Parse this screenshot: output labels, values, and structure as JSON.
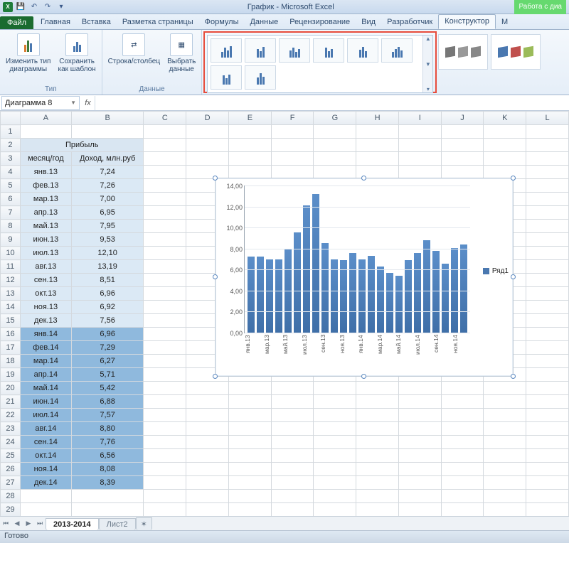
{
  "app": {
    "title": "График - Microsoft Excel",
    "chart_tools": "Работа с диа"
  },
  "qat": {
    "save": "save-icon",
    "undo": "undo-icon",
    "redo": "redo-icon"
  },
  "tabs": {
    "file": "Файл",
    "items": [
      "Главная",
      "Вставка",
      "Разметка страницы",
      "Формулы",
      "Данные",
      "Рецензирование",
      "Вид",
      "Разработчик"
    ],
    "active": "Конструктор",
    "more": "М"
  },
  "ribbon": {
    "type_group": {
      "change": "Изменить тип\nдиаграммы",
      "save_tpl": "Сохранить\nкак шаблон",
      "label": "Тип"
    },
    "data_group": {
      "switch": "Строка/столбец",
      "select": "Выбрать\nданные",
      "label": "Данные"
    },
    "styles_3d": [
      "preset-1",
      "preset-2"
    ]
  },
  "namebox": "Диаграмма 8",
  "fx_label": "fx",
  "columns": [
    "A",
    "B",
    "C",
    "D",
    "E",
    "F",
    "G",
    "H",
    "I",
    "J",
    "K",
    "L"
  ],
  "table": {
    "title": "Прибыль",
    "h1": "месяц/год",
    "h2": "Доход, млн.руб",
    "rows": [
      {
        "m": "янв.13",
        "v": "7,24",
        "cls": "d13"
      },
      {
        "m": "фев.13",
        "v": "7,26",
        "cls": "d13"
      },
      {
        "m": "мар.13",
        "v": "7,00",
        "cls": "d13"
      },
      {
        "m": "апр.13",
        "v": "6,95",
        "cls": "d13"
      },
      {
        "m": "май.13",
        "v": "7,95",
        "cls": "d13"
      },
      {
        "m": "июн.13",
        "v": "9,53",
        "cls": "d13"
      },
      {
        "m": "июл.13",
        "v": "12,10",
        "cls": "d13"
      },
      {
        "m": "авг.13",
        "v": "13,19",
        "cls": "d13"
      },
      {
        "m": "сен.13",
        "v": "8,51",
        "cls": "d13"
      },
      {
        "m": "окт.13",
        "v": "6,96",
        "cls": "d13"
      },
      {
        "m": "ноя.13",
        "v": "6,92",
        "cls": "d13"
      },
      {
        "m": "дек.13",
        "v": "7,56",
        "cls": "d13"
      },
      {
        "m": "янв.14",
        "v": "6,96",
        "cls": "d14"
      },
      {
        "m": "фев.14",
        "v": "7,29",
        "cls": "d14"
      },
      {
        "m": "мар.14",
        "v": "6,27",
        "cls": "d14"
      },
      {
        "m": "апр.14",
        "v": "5,71",
        "cls": "d14"
      },
      {
        "m": "май.14",
        "v": "5,42",
        "cls": "d14"
      },
      {
        "m": "июн.14",
        "v": "6,88",
        "cls": "d14"
      },
      {
        "m": "июл.14",
        "v": "7,57",
        "cls": "d14"
      },
      {
        "m": "авг.14",
        "v": "8,80",
        "cls": "d14"
      },
      {
        "m": "сен.14",
        "v": "7,76",
        "cls": "d14"
      },
      {
        "m": "окт.14",
        "v": "6,56",
        "cls": "d14"
      },
      {
        "m": "ноя.14",
        "v": "8,08",
        "cls": "d14"
      },
      {
        "m": "дек.14",
        "v": "8,39",
        "cls": "d14"
      }
    ]
  },
  "chart_data": {
    "type": "bar",
    "title": "",
    "xlabel": "",
    "ylabel": "",
    "ylim": [
      0,
      14
    ],
    "yticks": [
      "0,00",
      "2,00",
      "4,00",
      "6,00",
      "8,00",
      "10,00",
      "12,00",
      "14,00"
    ],
    "categories": [
      "янв.13",
      "фев.13",
      "мар.13",
      "апр.13",
      "май.13",
      "июн.13",
      "июл.13",
      "авг.13",
      "сен.13",
      "окт.13",
      "ноя.13",
      "дек.13",
      "янв.14",
      "фев.14",
      "мар.14",
      "апр.14",
      "май.14",
      "июн.14",
      "июл.14",
      "авг.14",
      "сен.14",
      "окт.14",
      "ноя.14",
      "дек.14"
    ],
    "xtick_labels": [
      "янв.13",
      "мар.13",
      "май.13",
      "июл.13",
      "сен.13",
      "ноя.13",
      "янв.14",
      "мар.14",
      "май.14",
      "июл.14",
      "сен.14",
      "ноя.14"
    ],
    "series": [
      {
        "name": "Ряд1",
        "values": [
          7.24,
          7.26,
          7.0,
          6.95,
          7.95,
          9.53,
          12.1,
          13.19,
          8.51,
          6.96,
          6.92,
          7.56,
          6.96,
          7.29,
          6.27,
          5.71,
          5.42,
          6.88,
          7.57,
          8.8,
          7.76,
          6.56,
          8.08,
          8.39
        ]
      }
    ],
    "legend": "Ряд1"
  },
  "sheets": {
    "active": "2013-2014",
    "other": "Лист2"
  },
  "status": "Готово"
}
